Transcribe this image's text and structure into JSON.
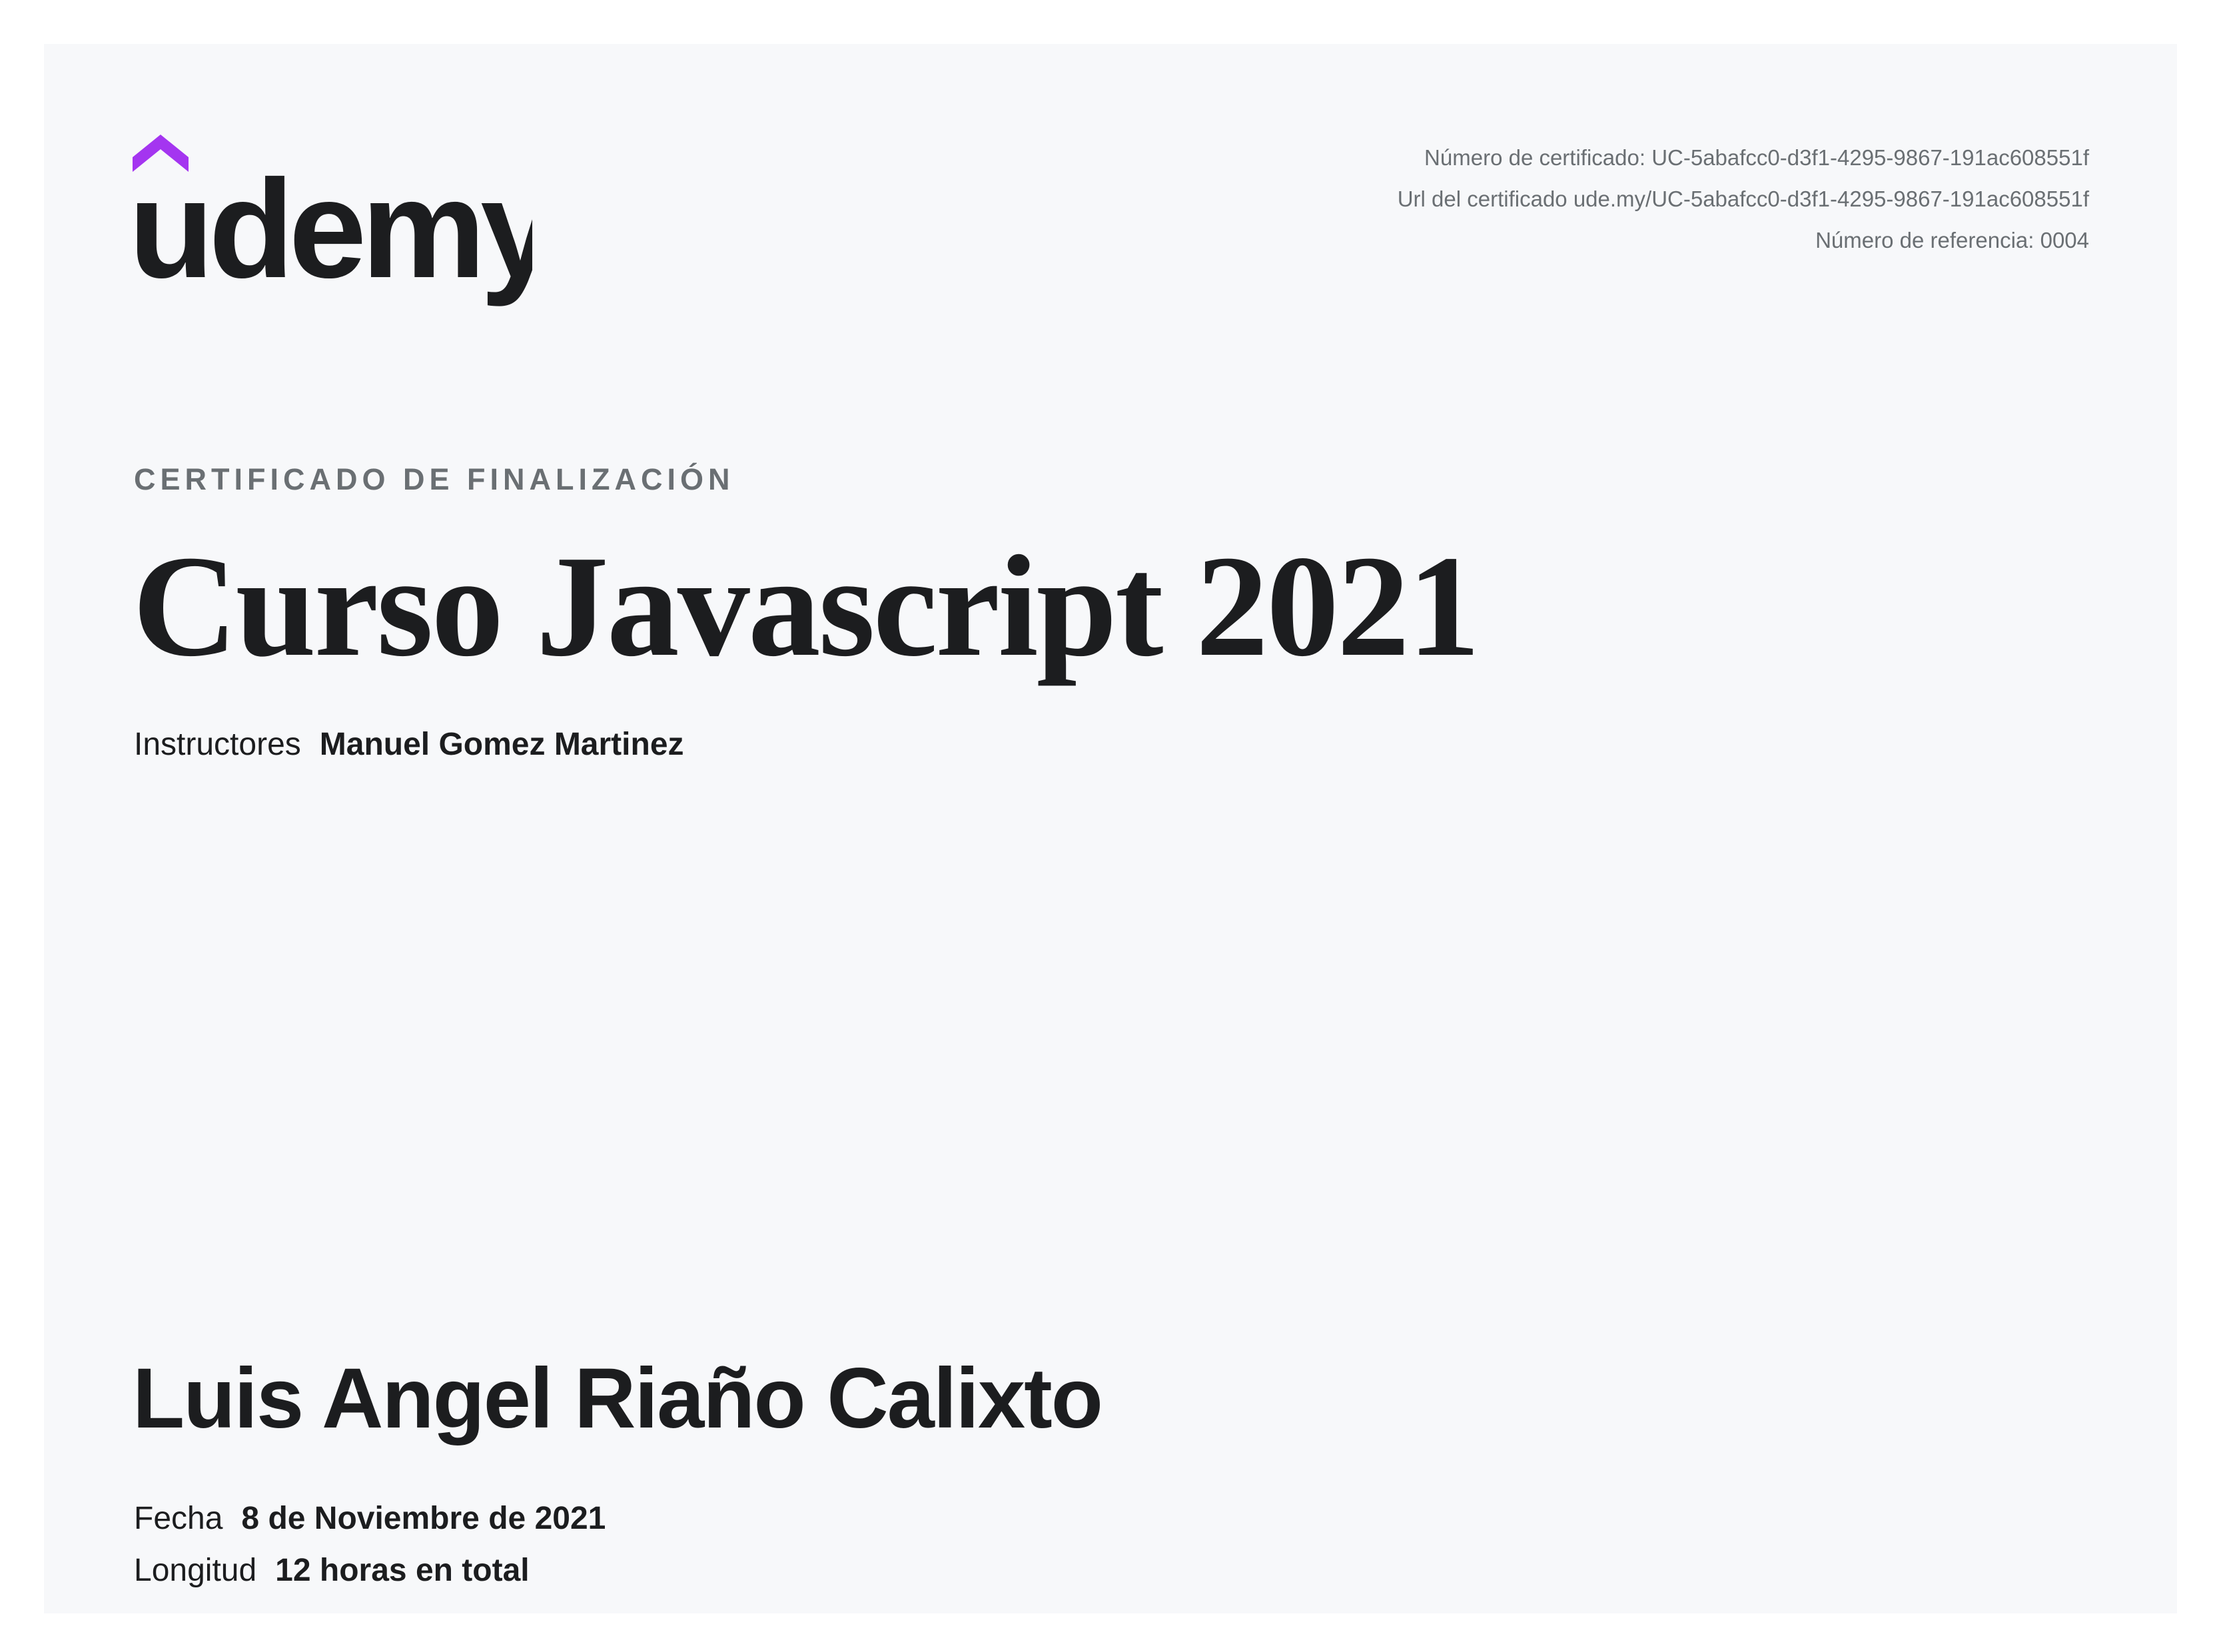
{
  "brand": {
    "name": "udemy",
    "accent_color": "#a435f0",
    "text_color": "#1c1d1f"
  },
  "certificate_meta": {
    "number_line": "Número de certificado: UC-5abafcc0-d3f1-4295-9867-191ac608551f",
    "url_line": "Url del certificado ude.my/UC-5abafcc0-d3f1-4295-9867-191ac608551f",
    "reference_line": "Número de referencia: 0004"
  },
  "certificate": {
    "kicker": "CERTIFICADO DE FINALIZACIÓN",
    "course_title": "Curso Javascript 2021",
    "instructors_label": "Instructores",
    "instructors_value": "Manuel Gomez Martinez",
    "student_name": "Luis Angel Riaño Calixto",
    "date_label": "Fecha",
    "date_value": "8 de Noviembre de 2021",
    "length_label": "Longitud",
    "length_value": "12 horas en total"
  },
  "colors": {
    "page_background": "#ffffff",
    "sheet_background": "#f7f8fa",
    "muted_text": "#6a6f73",
    "main_text": "#1c1d1f"
  }
}
